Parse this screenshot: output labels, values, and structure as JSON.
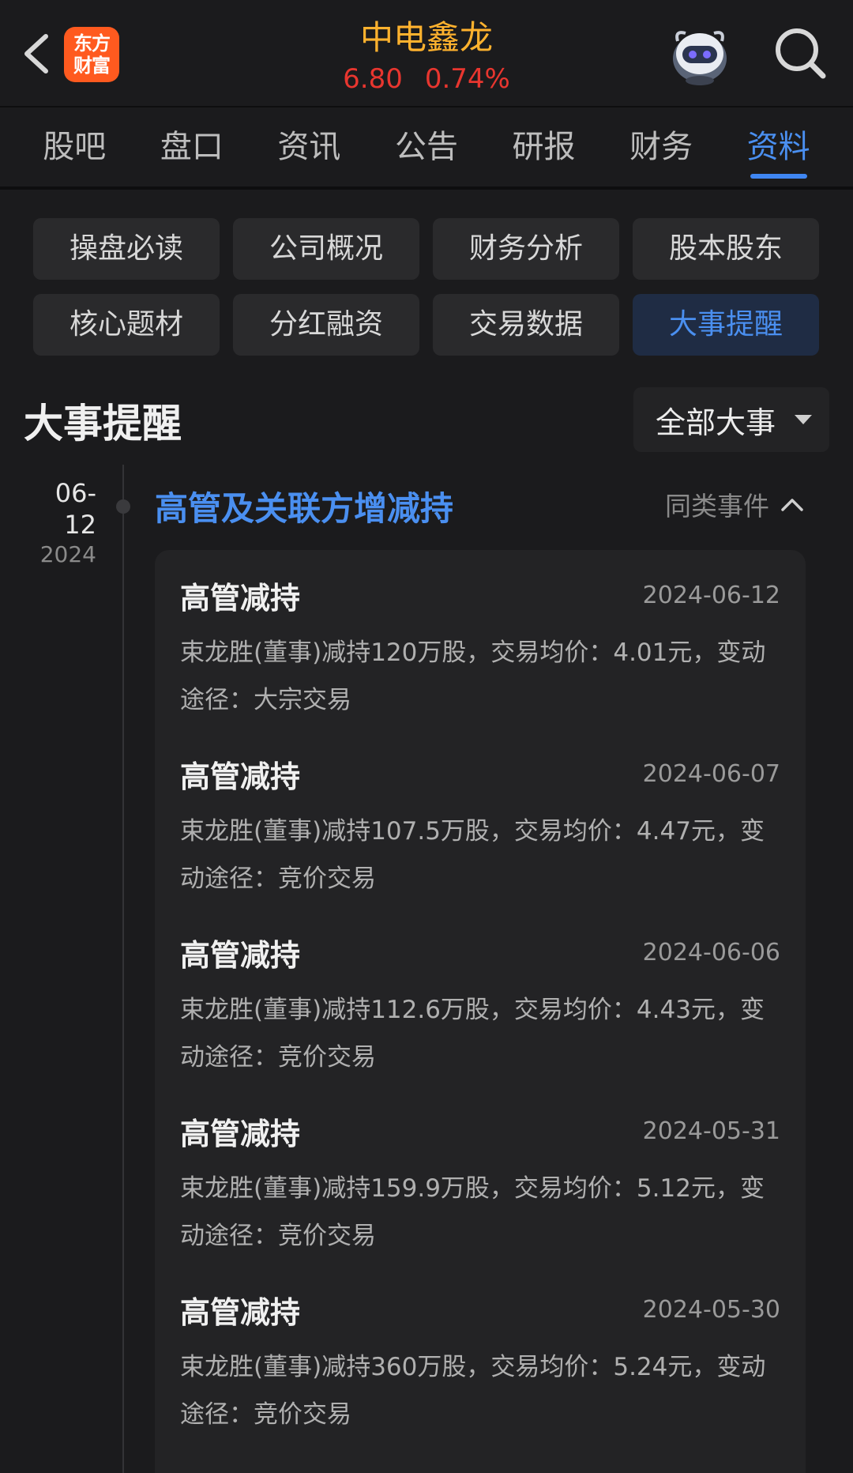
{
  "header": {
    "logo_line1": "东方",
    "logo_line2": "财富",
    "stock_name": "中电鑫龙",
    "price": "6.80",
    "change_pct": "0.74%",
    "price_color": "#e8362f",
    "name_color": "#ffb22e",
    "icons": [
      "back-arrow-icon",
      "robot-assistant-icon",
      "search-icon"
    ]
  },
  "tabs": [
    {
      "label": "股吧"
    },
    {
      "label": "盘口"
    },
    {
      "label": "资讯"
    },
    {
      "label": "公告"
    },
    {
      "label": "研报"
    },
    {
      "label": "财务"
    },
    {
      "label": "资料",
      "active": true
    }
  ],
  "sub_buttons": [
    {
      "label": "操盘必读"
    },
    {
      "label": "公司概况"
    },
    {
      "label": "财务分析"
    },
    {
      "label": "股本股东"
    },
    {
      "label": "核心题材"
    },
    {
      "label": "分红融资"
    },
    {
      "label": "交易数据"
    },
    {
      "label": "大事提醒",
      "active": true
    }
  ],
  "section": {
    "title": "大事提醒",
    "filter_label": "全部大事"
  },
  "timeline": {
    "date_md": "06-12",
    "date_year": "2024",
    "event_title": "高管及关联方增减持",
    "similar_label": "同类事件",
    "accent": "#4a8ff0",
    "items": [
      {
        "type": "高管减持",
        "date": "2024-06-12",
        "desc": "束龙胜(董事)减持120万股，交易均价：4.01元，变动途径：大宗交易"
      },
      {
        "type": "高管减持",
        "date": "2024-06-07",
        "desc": "束龙胜(董事)减持107.5万股，交易均价：4.47元，变动途径：竞价交易"
      },
      {
        "type": "高管减持",
        "date": "2024-06-06",
        "desc": "束龙胜(董事)减持112.6万股，交易均价：4.43元，变动途径：竞价交易"
      },
      {
        "type": "高管减持",
        "date": "2024-05-31",
        "desc": "束龙胜(董事)减持159.9万股，交易均价：5.12元，变动途径：竞价交易"
      },
      {
        "type": "高管减持",
        "date": "2024-05-30",
        "desc": "束龙胜(董事)减持360万股，交易均价：5.24元，变动途径：竞价交易"
      }
    ]
  }
}
